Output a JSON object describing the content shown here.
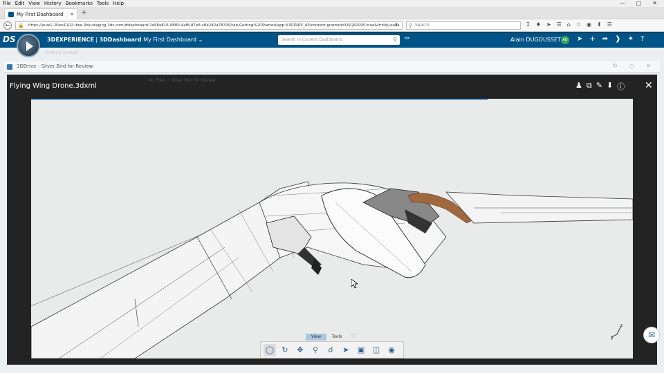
{
  "browser": {
    "menu": [
      "File",
      "Edit",
      "View",
      "History",
      "Bookmarks",
      "Tools",
      "Help"
    ],
    "tab_title": "My First Dashboard",
    "url": "https://euw1-20ws1102-ifwe.3dx-staging.3ds.com/#dashboard:2a58a816-8880-4af8-87e8-c8e282a78330/tab:Getting%20Started/app:X3DDRIV_AP/content:granted=DSQ41095:true&firstlyLoads",
    "search_placeholder": "Search"
  },
  "appbar": {
    "brand": "3DEXPERIENCE",
    "separator": " | ",
    "app": "3DDashboard",
    "dashboard": "My First Dashboard",
    "search_placeholder": "Search in Current Dashboard",
    "user_name": "Alain DUGOUSSET",
    "user_initials": "AD"
  },
  "dashboard": {
    "subtitle": "Getting Started"
  },
  "widget": {
    "title": "3DDrive - Silver Bird for Review"
  },
  "viewer": {
    "file_title": "Flying Wing Drone.3dxml",
    "breadcrumb": "My Files > Silver Bird for Review",
    "toolbar_tabs": [
      "View",
      "Tools"
    ],
    "active_tab": "View"
  },
  "icons": {
    "viewer_tools": [
      "add-user-icon",
      "copy-icon",
      "pencil-icon",
      "download-icon",
      "info-icon"
    ],
    "toolbar": [
      "fit-all-icon",
      "rotate-icon",
      "pan-icon",
      "zoom-window-icon",
      "zoom-icon",
      "select-icon",
      "cube-view-icon",
      "section-icon",
      "visibility-icon"
    ]
  },
  "colors": {
    "brand": "#005386",
    "viewer_bg": "#1c1c1c",
    "canvas_bg": "#e9eaea",
    "progress": "#5aa0d6"
  }
}
